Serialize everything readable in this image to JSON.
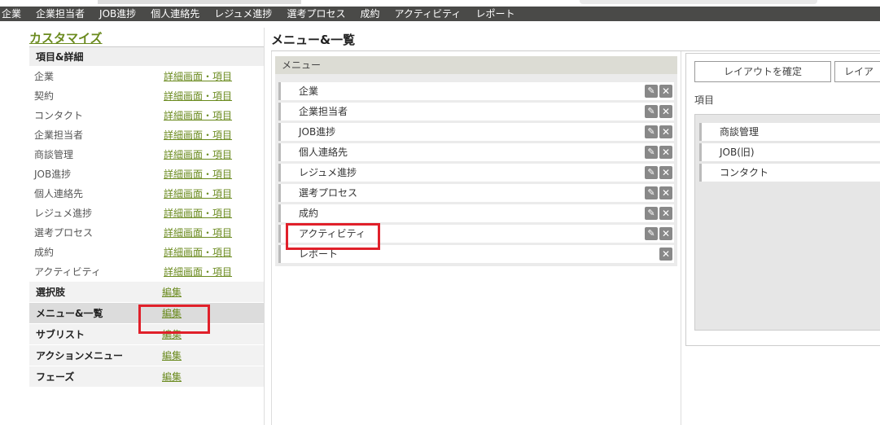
{
  "nav": [
    "企業",
    "企業担当者",
    "JOB進捗",
    "個人連絡先",
    "レジュメ進捗",
    "選考プロセス",
    "成約",
    "アクティビティ",
    "レポート"
  ],
  "left": {
    "title": "カスタマイズ",
    "section_items": "項目&詳細",
    "rows": [
      {
        "label": "企業",
        "link": "詳細画面・項目"
      },
      {
        "label": "契約",
        "link": "詳細画面・項目"
      },
      {
        "label": "コンタクト",
        "link": "詳細画面・項目"
      },
      {
        "label": "企業担当者",
        "link": "詳細画面・項目"
      },
      {
        "label": "商談管理",
        "link": "詳細画面・項目"
      },
      {
        "label": "JOB進捗",
        "link": "詳細画面・項目"
      },
      {
        "label": "個人連絡先",
        "link": "詳細画面・項目"
      },
      {
        "label": "レジュメ進捗",
        "link": "詳細画面・項目"
      },
      {
        "label": "選考プロセス",
        "link": "詳細画面・項目"
      },
      {
        "label": "成約",
        "link": "詳細画面・項目"
      },
      {
        "label": "アクティビティ",
        "link": "詳細画面・項目"
      }
    ],
    "sections": [
      {
        "label": "選択肢",
        "link": "編集"
      },
      {
        "label": "メニュー&一覧",
        "link": "編集"
      },
      {
        "label": "サブリスト",
        "link": "編集"
      },
      {
        "label": "アクションメニュー",
        "link": "編集"
      },
      {
        "label": "フェーズ",
        "link": "編集"
      }
    ]
  },
  "main": {
    "title": "メニュー&一覧",
    "menu_header": "メニュー",
    "menu_items": [
      "企業",
      "企業担当者",
      "JOB進捗",
      "個人連絡先",
      "レジュメ進捗",
      "選考プロセス",
      "成約",
      "アクティビティ",
      "レポート"
    ],
    "edit_icon": "✎",
    "close_icon": "✕"
  },
  "right": {
    "confirm_button": "レイアウトを確定",
    "second_button": "レイア",
    "items_label": "項目",
    "items": [
      "商談管理",
      "JOB(旧)",
      "コンタクト"
    ]
  },
  "colors": {
    "accent": "#6a8a1e",
    "highlight": "#e0202a",
    "topbar": "#4a4a48"
  }
}
